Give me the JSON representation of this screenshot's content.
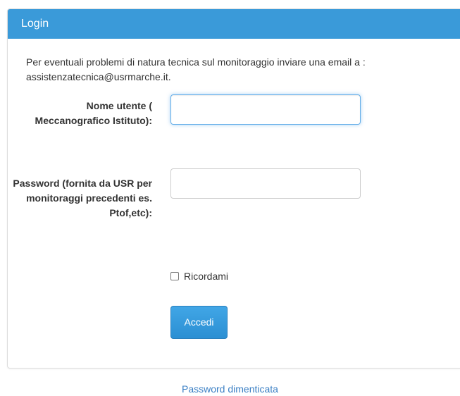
{
  "panel": {
    "title": "Login"
  },
  "notice": {
    "text": "Per eventuali problemi di natura tecnica sul monitoraggio inviare una email a : assistenzatecnica@usrmarche.it."
  },
  "form": {
    "username_label": "Nome utente ( Meccanografico Istituto):",
    "username_value": "",
    "password_label": "Password (fornita da USR per monitoraggi precedenti es. Ptof,etc):",
    "password_value": "",
    "remember_label": "Ricordami",
    "remember_checked": false,
    "submit_label": "Accedi"
  },
  "links": {
    "forgot_password": "Password dimenticata"
  },
  "colors": {
    "heading_bg": "#3a9ad9",
    "button_bg": "#2b8fd3",
    "link": "#3a7fc4"
  }
}
